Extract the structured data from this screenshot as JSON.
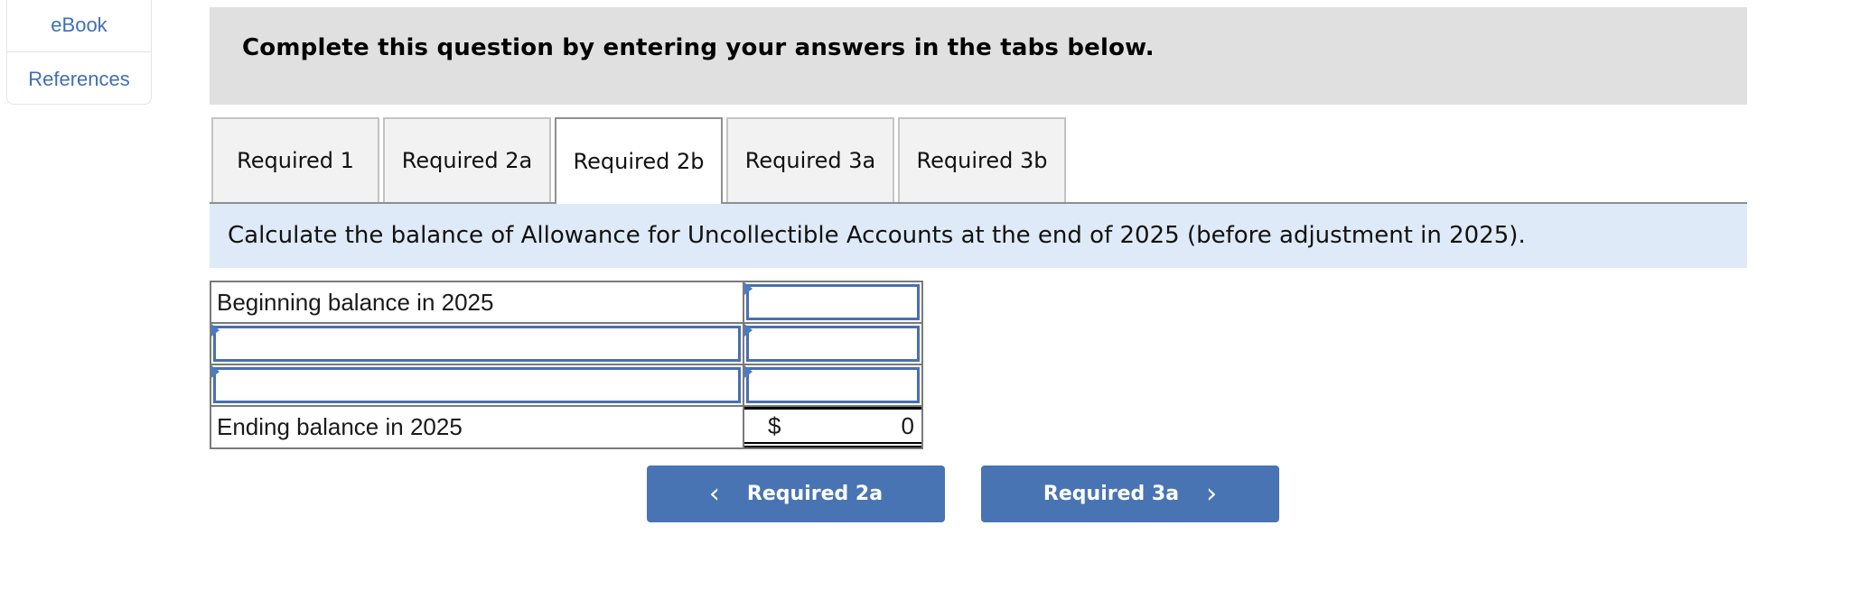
{
  "sidebar": {
    "items": [
      {
        "label": "eBook"
      },
      {
        "label": "References"
      }
    ]
  },
  "instructions": {
    "text": "Complete this question by entering your answers in the tabs below."
  },
  "tabs": [
    {
      "label": "Required 1",
      "active": false
    },
    {
      "label": "Required 2a",
      "active": false
    },
    {
      "label": "Required 2b",
      "active": true
    },
    {
      "label": "Required 3a",
      "active": false
    },
    {
      "label": "Required 3b",
      "active": false
    }
  ],
  "question": {
    "text": "Calculate the balance of Allowance for Uncollectible Accounts at the end of 2025 (before adjustment in 2025)."
  },
  "table": {
    "rows": [
      {
        "label": "Beginning balance in 2025",
        "label_editable": false,
        "value": ""
      },
      {
        "label": "",
        "label_editable": true,
        "value": ""
      },
      {
        "label": "",
        "label_editable": true,
        "value": ""
      },
      {
        "label": "Ending balance in 2025",
        "label_editable": false,
        "currency": "$",
        "value": "0"
      }
    ]
  },
  "navigation": {
    "prev_label": "Required 2a",
    "next_label": "Required 3a",
    "prev_icon": "chevron-left-icon",
    "next_icon": "chevron-right-icon",
    "prev_glyph": "‹",
    "next_glyph": "›"
  },
  "colors": {
    "accent": "#4874b4",
    "link": "#3f6fb5",
    "instruction_bg": "#e0e0e0",
    "question_bg": "#deeaf7",
    "input_border": "#4a6fb0"
  }
}
